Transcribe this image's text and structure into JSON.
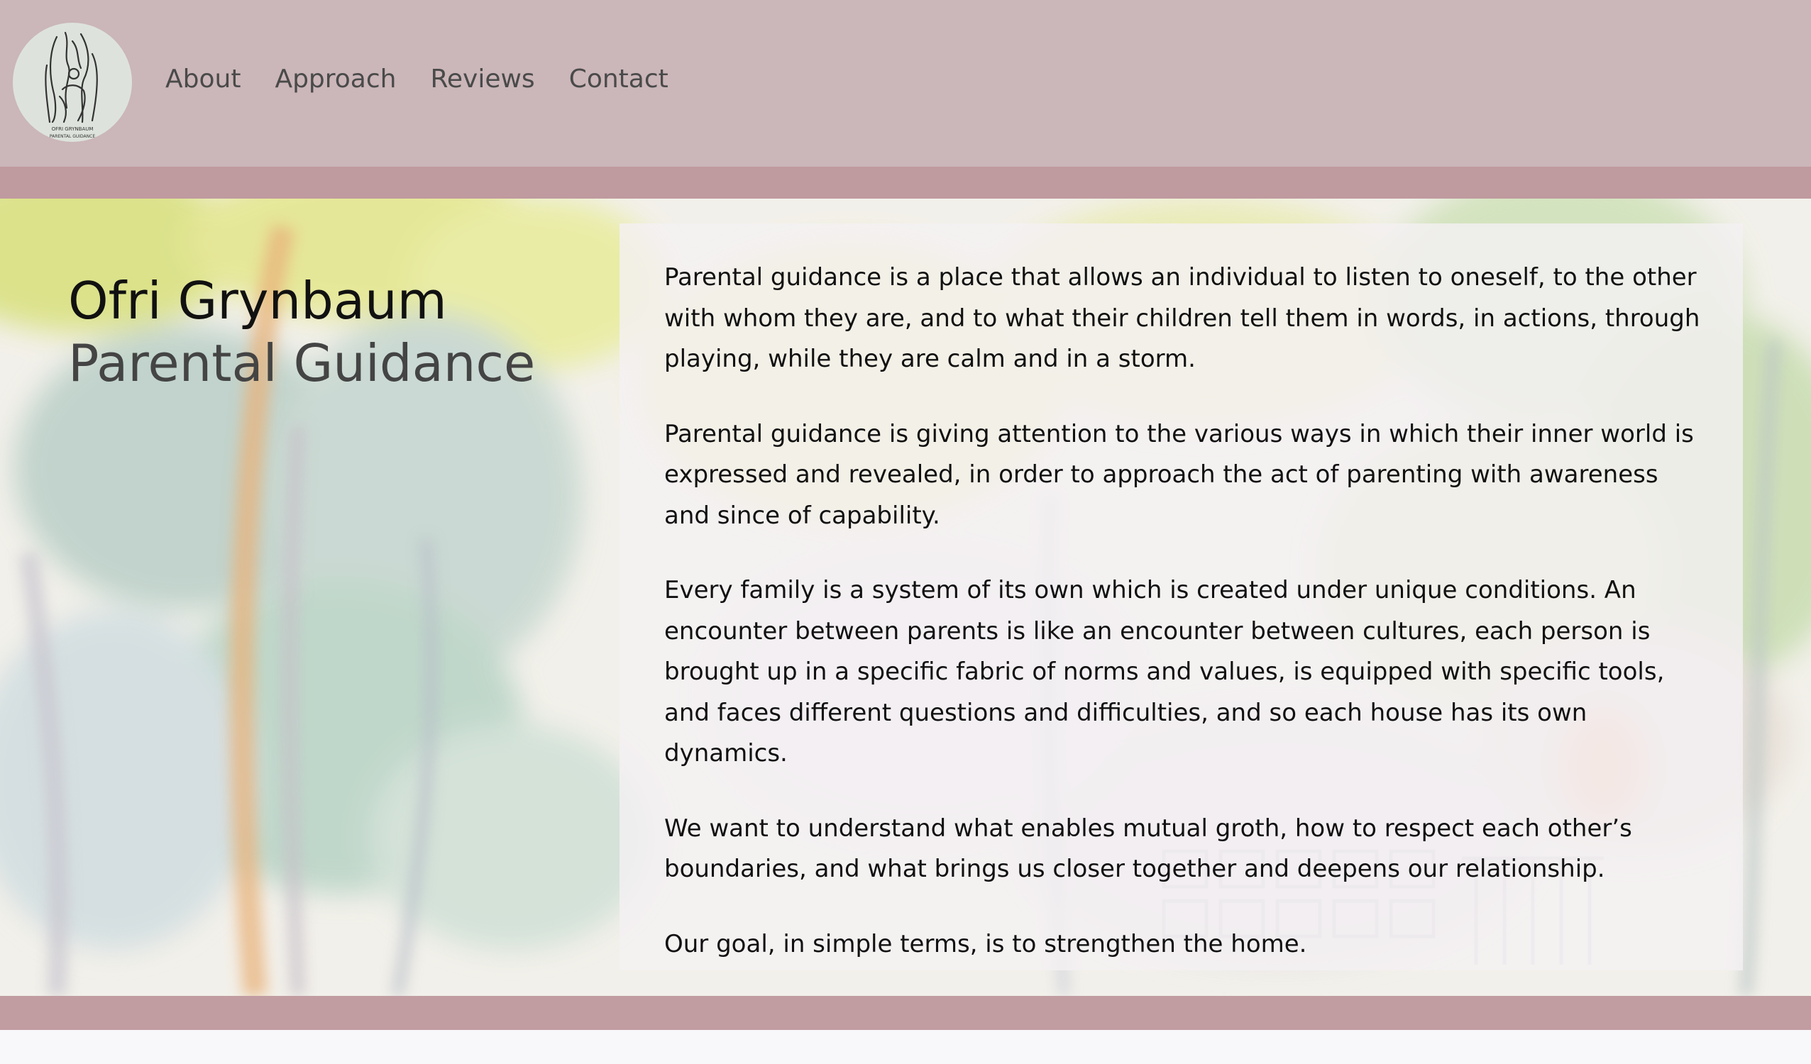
{
  "header": {
    "logo": {
      "icon": "family-line-drawing-icon",
      "text_line1": "OFRI GRYNBAUM",
      "text_line2": "PARENTAL GUIDANCE"
    },
    "nav": [
      "About",
      "Approach",
      "Reviews",
      "Contact"
    ]
  },
  "hero": {
    "title_name": "Ofri Grynbaum",
    "title_sub": "Parental Guidance",
    "paragraphs": [
      "Parental guidance is a place that allows an individual to listen to oneself, to the other with whom they are, and to what their children tell them in words, in actions, through playing, while they are calm and in a storm.",
      "Parental guidance is giving attention to the various ways in which their inner world is expressed and revealed, in order to approach the act of parenting with awareness and since of capability.",
      "Every family is a system of its own which is created under unique conditions. An encounter between parents is like an encounter between cultures, each person is brought up in a specific fabric of norms and values, is equipped with specific tools, and faces different questions and difficulties, and so each house has its own dynamics.",
      "We want to understand what enables mutual groth, how to respect each other’s boundaries, and what brings us closer together and deepens our relationship.",
      "Our goal, in simple terms, is to strengthen the home."
    ],
    "background": "watercolor-trees-illustration"
  },
  "colors": {
    "header_bg": "#cbb6b9",
    "band": "#bf9a9f",
    "logo_bg": "#dde3dc",
    "panel_bg": "#f4f0f3",
    "text": "#111111",
    "nav_text": "#4a4a4a"
  }
}
